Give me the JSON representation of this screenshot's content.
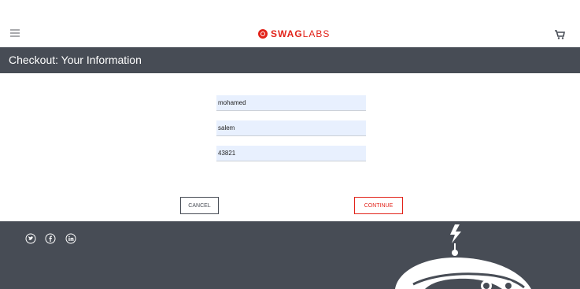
{
  "header": {
    "logo_bold": "SWAG",
    "logo_light": "LABS",
    "brand_color": "#e2231a",
    "menu_icon": "hamburger-menu-icon",
    "cart_icon": "shopping-cart-icon"
  },
  "subheader": {
    "title": "Checkout: Your Information"
  },
  "form": {
    "first_name": "mohamed",
    "last_name": "salem",
    "postal_code": "43821"
  },
  "buttons": {
    "cancel": "CANCEL",
    "continue": "CONTINUE"
  },
  "footer": {
    "background": "#474c55",
    "social_icons": [
      "twitter-icon",
      "facebook-icon",
      "linkedin-icon"
    ]
  }
}
